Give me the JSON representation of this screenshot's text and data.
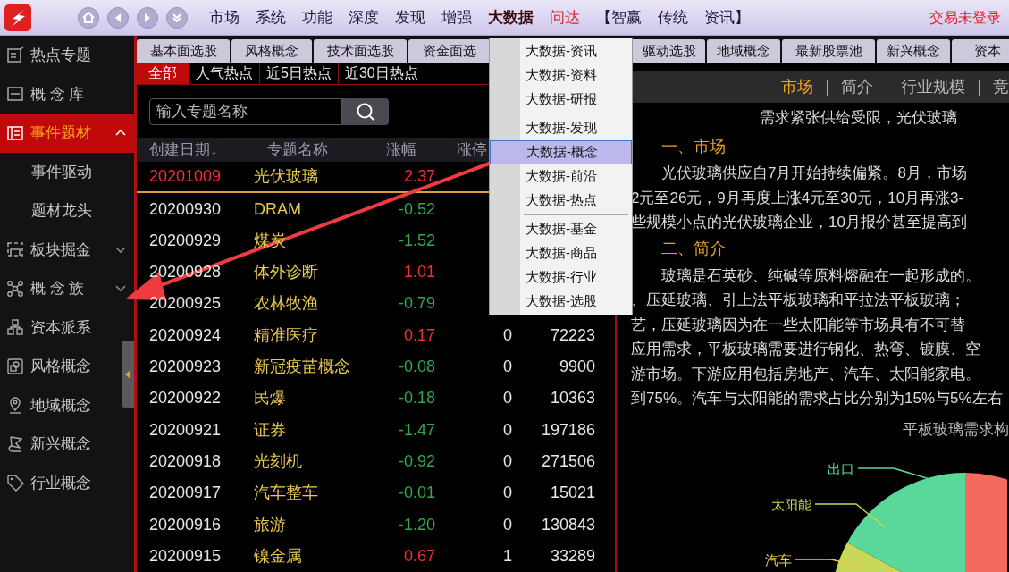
{
  "top_menu": [
    {
      "label": "市场",
      "kind": "normal"
    },
    {
      "label": "系统",
      "kind": "normal"
    },
    {
      "label": "功能",
      "kind": "normal"
    },
    {
      "label": "深度",
      "kind": "normal"
    },
    {
      "label": "发现",
      "kind": "normal"
    },
    {
      "label": "增强",
      "kind": "normal"
    },
    {
      "label": "大数据",
      "kind": "open"
    },
    {
      "label": "问达",
      "kind": "accent"
    },
    {
      "label": "【智赢",
      "kind": "normal"
    },
    {
      "label": "传统",
      "kind": "normal"
    },
    {
      "label": "资讯】",
      "kind": "normal"
    }
  ],
  "login_status": "交易未登录",
  "sidebar": [
    {
      "label": "热点专题",
      "kind": "link",
      "selected": false
    },
    {
      "label": "概 念 库",
      "kind": "link",
      "selected": false
    },
    {
      "label": "事件题材",
      "kind": "group",
      "selected": true,
      "expanded": true,
      "children": [
        {
          "label": "事件驱动",
          "selected": false
        },
        {
          "label": "题材龙头",
          "selected": false
        }
      ]
    },
    {
      "label": "板块掘金",
      "kind": "group",
      "selected": false,
      "expanded": false
    },
    {
      "label": "概 念 族",
      "kind": "group",
      "selected": false,
      "expanded": false
    },
    {
      "label": "资本派系",
      "kind": "link",
      "selected": false
    },
    {
      "label": "风格概念",
      "kind": "link",
      "selected": false
    },
    {
      "label": "地域概念",
      "kind": "link",
      "selected": false
    },
    {
      "label": "新兴概念",
      "kind": "link",
      "selected": false
    },
    {
      "label": "行业概念",
      "kind": "link",
      "selected": false
    }
  ],
  "tabs": [
    {
      "label": "基本面选股",
      "selected": false
    },
    {
      "label": "风格概念",
      "selected": false
    },
    {
      "label": "技术面选股",
      "selected": false
    },
    {
      "label": "资金面选",
      "selected": false
    },
    {
      "label": "驱动选股",
      "selected": false
    },
    {
      "label": "地域概念",
      "selected": false
    },
    {
      "label": "最新股票池",
      "selected": false
    },
    {
      "label": "新兴概念",
      "selected": false
    },
    {
      "label": "资本",
      "selected": false
    }
  ],
  "sub_tabs": [
    {
      "label": "全部",
      "selected": true
    },
    {
      "label": "人气热点",
      "selected": false
    },
    {
      "label": "近5日热点",
      "selected": false
    },
    {
      "label": "近30日热点",
      "selected": false
    }
  ],
  "search": {
    "placeholder": "输入专题名称"
  },
  "table": {
    "columns": [
      "创建日期↓",
      "专题名称",
      "涨幅",
      "涨停"
    ],
    "rows": [
      {
        "date": "20201009",
        "name": "光伏玻璃",
        "change": "2.37",
        "color": "#f03030",
        "selected": true
      },
      {
        "date": "20200930",
        "name": "DRAM",
        "change": "-0.52",
        "color": "#30a850",
        "selected": false
      },
      {
        "date": "20200929",
        "name": "煤炭",
        "change": "-1.52",
        "color": "#30a850",
        "selected": false
      },
      {
        "date": "20200928",
        "name": "体外诊断",
        "change": "1.01",
        "color": "#f03030",
        "selected": false
      },
      {
        "date": "20200925",
        "name": "农林牧渔",
        "change": "-0.79",
        "color": "#30a850",
        "selected": false
      },
      {
        "date": "20200924",
        "name": "精准医疗",
        "change": "0.17",
        "color": "#f03030",
        "limit_up": "0",
        "column_5": "72223",
        "selected": false
      },
      {
        "date": "20200923",
        "name": "新冠疫苗概念",
        "change": "-0.08",
        "color": "#30a850",
        "limit_up": "0",
        "column_5": "9900",
        "selected": false
      },
      {
        "date": "20200922",
        "name": "民爆",
        "change": "-0.18",
        "color": "#30a850",
        "limit_up": "0",
        "column_5": "10363",
        "selected": false
      },
      {
        "date": "20200921",
        "name": "证券",
        "change": "-1.47",
        "color": "#30a850",
        "limit_up": "0",
        "column_5": "197186",
        "selected": false
      },
      {
        "date": "20200918",
        "name": "光刻机",
        "change": "-0.92",
        "color": "#30a850",
        "limit_up": "0",
        "column_5": "271506",
        "selected": false
      },
      {
        "date": "20200917",
        "name": "汽车整车",
        "change": "-0.01",
        "color": "#30a850",
        "limit_up": "0",
        "column_5": "15021",
        "selected": false
      },
      {
        "date": "20200916",
        "name": "旅游",
        "change": "-1.20",
        "color": "#30a850",
        "limit_up": "0",
        "column_5": "130843",
        "selected": false
      },
      {
        "date": "20200915",
        "name": "镍金属",
        "change": "0.67",
        "color": "#f03030",
        "limit_up": "1",
        "column_5": "33289",
        "selected": false
      }
    ]
  },
  "dropdown": {
    "groups": [
      [
        {
          "label": "大数据-资讯",
          "selected": false
        },
        {
          "label": "大数据-资料",
          "selected": false
        },
        {
          "label": "大数据-研报",
          "selected": false
        }
      ],
      [
        {
          "label": "大数据-发现",
          "selected": false
        },
        {
          "label": "大数据-概念",
          "selected": true
        },
        {
          "label": "大数据-前沿",
          "selected": false
        },
        {
          "label": "大数据-热点",
          "selected": false
        }
      ],
      [
        {
          "label": "大数据-基金",
          "selected": false
        },
        {
          "label": "大数据-商品",
          "selected": false
        },
        {
          "label": "大数据-行业",
          "selected": false
        },
        {
          "label": "大数据-选股",
          "selected": false
        }
      ]
    ]
  },
  "detail": {
    "tabs": [
      {
        "label": "市场",
        "selected": true
      },
      {
        "label": "简介",
        "selected": false
      },
      {
        "label": "行业规模",
        "selected": false
      },
      {
        "label": "竞",
        "selected": false
      }
    ],
    "title": "需求紧张供给受限，光伏玻璃",
    "lines": [
      {
        "kind": "heading",
        "text": "一、市场"
      },
      {
        "kind": "indent",
        "text": "光伏玻璃供应自7月开始持续偏紧。8月，市场"
      },
      {
        "kind": "plain",
        "text": "2元至26元，9月再度上涨4元至30元，10月再涨3-"
      },
      {
        "kind": "plain",
        "text": "些规模小点的光伏玻璃企业，10月报价甚至提高到"
      },
      {
        "kind": "heading",
        "text": "二、简介"
      },
      {
        "kind": "indent",
        "text": "玻璃是石英砂、纯碱等原料熔融在一起形成的。"
      },
      {
        "kind": "plain",
        "text": "、压延玻璃、引上法平板玻璃和平拉法平板玻璃；"
      },
      {
        "kind": "plain",
        "text": "艺，压延玻璃因为在一些太阳能等市场具有不可替"
      },
      {
        "kind": "plain",
        "text": "应用需求，平板玻璃需要进行钢化、热弯、镀膜、空"
      },
      {
        "kind": "plain",
        "text": "游市场。下游应用包括房地产、汽车、太阳能家电。"
      },
      {
        "kind": "plain",
        "text": "到75%。汽车与太阳能的需求占比分别为15%与5%左右"
      }
    ],
    "chart_title": "平板玻璃需求构",
    "pie_labels": [
      {
        "text": "出口",
        "color": "#5ad89a"
      },
      {
        "text": "太阳能",
        "color": "#c8d85a"
      },
      {
        "text": "汽车",
        "color": "#f0c850"
      }
    ]
  }
}
